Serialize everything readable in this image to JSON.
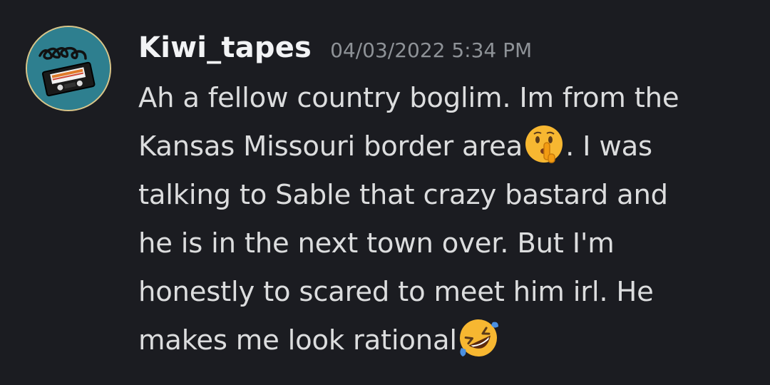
{
  "message": {
    "author": "Kiwi_tapes",
    "timestamp": "04/03/2022 5:34 PM",
    "avatar_icon": "vhs-tape-avatar",
    "lines": [
      {
        "before": "Ah a fellow country boglim. Im from the",
        "emoji": null,
        "after": ""
      },
      {
        "before": "Kansas Missouri border area",
        "emoji": "shushing-face",
        "after": ". I was"
      },
      {
        "before": "talking to Sable that crazy bastard and",
        "emoji": null,
        "after": ""
      },
      {
        "before": "he is in the next town over. But I'm",
        "emoji": null,
        "after": ""
      },
      {
        "before": "honestly to scared to meet him irl. He",
        "emoji": null,
        "after": ""
      },
      {
        "before": "makes me look rational",
        "emoji": "rolling-on-floor-laughing",
        "after": ""
      }
    ]
  },
  "colors": {
    "background": "#1b1c21",
    "username": "#f2f3f5",
    "timestamp": "#8e9297",
    "text": "#dcddde",
    "avatar_bg": "#2e7f8f"
  }
}
